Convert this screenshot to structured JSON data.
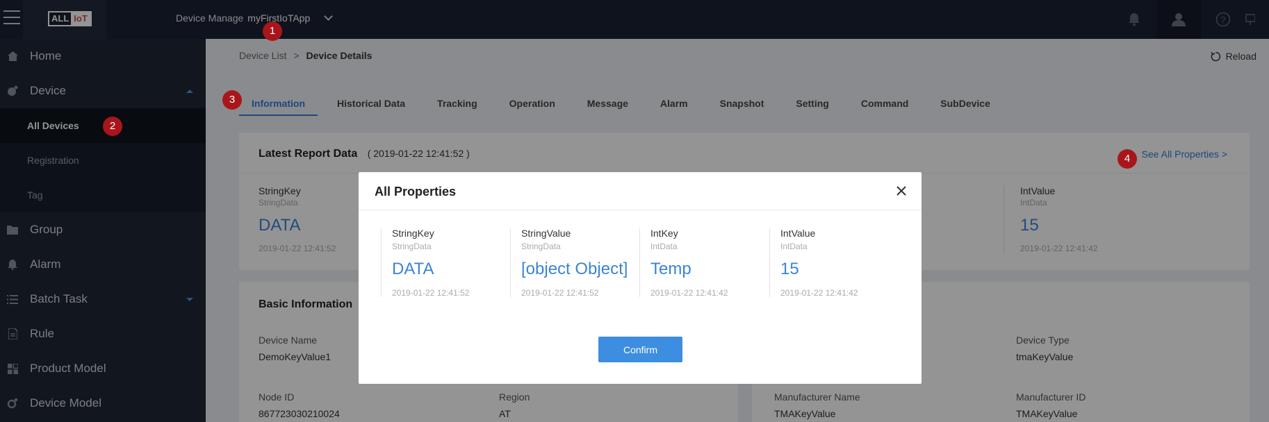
{
  "header": {
    "logo_part1": "ALL",
    "logo_part2": "IoT",
    "section_label": "Device Manage",
    "app_name": "myFirstIoTApp"
  },
  "badges": [
    "1",
    "2",
    "3",
    "4"
  ],
  "sidebar": {
    "items": [
      {
        "label": "Home",
        "icon": "home-icon"
      },
      {
        "label": "Device",
        "icon": "device-icon"
      },
      {
        "label": "Group",
        "icon": "folder-icon"
      },
      {
        "label": "Alarm",
        "icon": "bell-icon"
      },
      {
        "label": "Batch Task",
        "icon": "list-icon"
      },
      {
        "label": "Rule",
        "icon": "document-icon"
      },
      {
        "label": "Product Model",
        "icon": "grid-icon"
      },
      {
        "label": "Device Model",
        "icon": "gear-icon"
      }
    ],
    "device_subitems": [
      "All Devices",
      "Registration",
      "Tag"
    ]
  },
  "breadcrumb": {
    "parent": "Device List",
    "separator": ">",
    "current": "Device Details"
  },
  "reload_label": "Reload",
  "tabs": [
    "Information",
    "Historical Data",
    "Tracking",
    "Operation",
    "Message",
    "Alarm",
    "Snapshot",
    "Setting",
    "Command",
    "SubDevice"
  ],
  "latest_report": {
    "title": "Latest Report Data",
    "time": "( 2019-01-22 12:41:52 )",
    "see_all": "See All Properties >",
    "left": {
      "key": "StringKey",
      "type": "StringData",
      "value": "DATA",
      "timestamp": "2019-01-22 12:41:52"
    },
    "right": {
      "key": "IntValue",
      "type": "IntData",
      "value": "15",
      "timestamp": "2019-01-22 12:41:42"
    }
  },
  "basic_info": {
    "title": "Basic Information",
    "device_name": {
      "label": "Device Name",
      "value": "DemoKeyValue1"
    },
    "device_type": {
      "label": "Device Type",
      "value": "tmaKeyValue"
    },
    "node_id": {
      "label": "Node ID",
      "value": "867723030210024"
    },
    "region": {
      "label": "Region",
      "value": "AT"
    },
    "manufacturer_name": {
      "label": "Manufacturer Name",
      "value": "TMAKeyValue"
    },
    "manufacturer_id": {
      "label": "Manufacturer ID",
      "value": "TMAKeyValue"
    }
  },
  "modal": {
    "title": "All Properties",
    "confirm_label": "Confirm",
    "properties": [
      {
        "key": "StringKey",
        "type": "StringData",
        "value": "DATA",
        "timestamp": "2019-01-22 12:41:52"
      },
      {
        "key": "StringValue",
        "type": "StringData",
        "value": "[object Object]",
        "timestamp": "2019-01-22 12:41:52"
      },
      {
        "key": "IntKey",
        "type": "IntData",
        "value": "Temp",
        "timestamp": "2019-01-22 12:41:42"
      },
      {
        "key": "IntValue",
        "type": "IntData",
        "value": "15",
        "timestamp": "2019-01-22 12:41:42"
      }
    ]
  },
  "colors": {
    "accent": "#3d8de0",
    "badge": "#a8161b",
    "topbar": "#1b2234",
    "sidebar": "#1f2636"
  }
}
